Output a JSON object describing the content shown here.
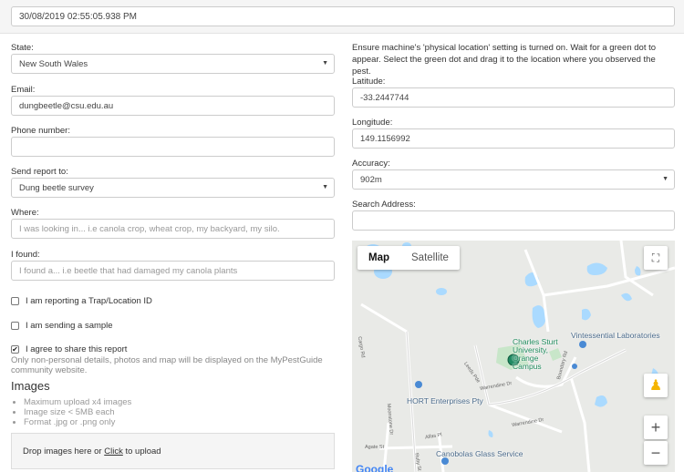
{
  "datetime_value": "30/08/2019 02:55:05.938 PM",
  "form": {
    "state_label": "State:",
    "state_value": "New South Wales",
    "email_label": "Email:",
    "email_value": "dungbeetle@csu.edu.au",
    "phone_label": "Phone number:",
    "phone_value": "",
    "send_label": "Send report to:",
    "send_value": "Dung beetle survey",
    "where_label": "Where:",
    "where_placeholder": "I was looking in... i.e canola crop, wheat crop, my backyard, my silo.",
    "found_label": "I found:",
    "found_placeholder": "I found a... i.e beetle that had damaged my canola plants",
    "trap_label": "I am reporting a Trap/Location ID",
    "sample_label": "I am sending a sample",
    "agree_label": "I agree to share this report",
    "agree_help": "Only non-personal details, photos and map will be displayed on the MyPestGuide community website.",
    "images_title": "Images",
    "image_rules": [
      "Maximum upload x4 images",
      "Image size < 5MB each",
      "Format .jpg or .png only"
    ],
    "drop_text_before": "Drop images here or ",
    "drop_link": "Click",
    "drop_text_after": " to upload"
  },
  "location": {
    "note": "Ensure machine's 'physical location' setting is turned on. Wait for a green dot to appear. Select the green dot and drag it to the location where you observed the pest.",
    "latitude_label": "Latitude:",
    "latitude_value": "-33.2447744",
    "longitude_label": "Longitude:",
    "longitude_value": "149.1156992",
    "accuracy_label": "Accuracy:",
    "accuracy_value": "902m",
    "search_label": "Search Address:",
    "search_value": ""
  },
  "map": {
    "tab_map": "Map",
    "tab_satellite": "Satellite",
    "labels": {
      "csu": "Charles Sturt\nUniversity,\nOrange\nCampus",
      "vintessential": "Vintessential Laboratories",
      "hort": "HORT Enterprises Pty",
      "canobolas": "Canobolas Glass Service",
      "google": "Google"
    },
    "roads": {
      "cargo": "Cargo Rd",
      "leeds": "Leeds Pde",
      "warrendine": "Warrendine Dr",
      "warrendine2": "Warrendine Dr",
      "boundary": "Boundary Rd",
      "agate": "Agate St",
      "moonstone": "Moonstone Dr",
      "alfas": "Alfas Pl",
      "ruby": "Ruby St"
    },
    "colors": {
      "water": "#aadaff",
      "green_dot": "#1f8a62",
      "park": "#c8e6c9"
    }
  }
}
